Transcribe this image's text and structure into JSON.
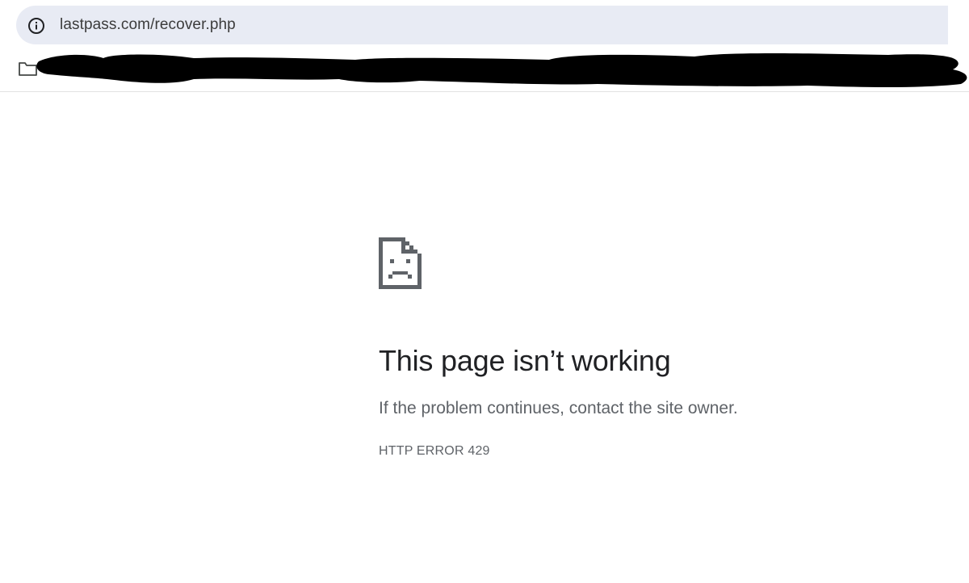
{
  "omnibox": {
    "url": "lastpass.com/recover.php",
    "info_icon": "info-circle-icon"
  },
  "bookmarks": {
    "folder_icon": "folder-icon",
    "redacted": true
  },
  "error": {
    "icon": "sad-page-icon",
    "title": "This page isn’t working",
    "description": "If the problem continues, contact the site owner.",
    "code": "HTTP ERROR 429"
  },
  "colors": {
    "omnibox_bg": "#e8ebf4",
    "title": "#202124",
    "secondary_text": "#5f6368",
    "redaction": "#000000"
  }
}
